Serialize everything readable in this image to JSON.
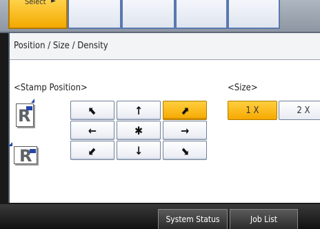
{
  "tabs": {
    "selected_label": "Select"
  },
  "panel": {
    "title": "Position / Size / Density",
    "stamp_position": {
      "label": "<Stamp Position>",
      "icon_letter": "R",
      "buttons": [
        {
          "label": "⬉",
          "direction": "top-left"
        },
        {
          "label": "↑",
          "direction": "top"
        },
        {
          "label": "⬈",
          "direction": "top-right",
          "selected": true
        },
        {
          "label": "←",
          "direction": "left"
        },
        {
          "label": "✱",
          "direction": "center"
        },
        {
          "label": "→",
          "direction": "right"
        },
        {
          "label": "⬋",
          "direction": "bottom-left"
        },
        {
          "label": "↓",
          "direction": "bottom"
        },
        {
          "label": "⬊",
          "direction": "bottom-right"
        }
      ]
    },
    "size": {
      "label": "<Size>",
      "options": [
        "1 X",
        "2 X"
      ],
      "selected": "1 X"
    }
  },
  "bottom_bar": {
    "system_status": "System Status",
    "job_list": "Job List"
  },
  "colors": {
    "selected": "#f6a800",
    "button_border": "#6f7f98",
    "bottom_bar": "#1a1a1a",
    "icon_accent": "#2446a8"
  }
}
